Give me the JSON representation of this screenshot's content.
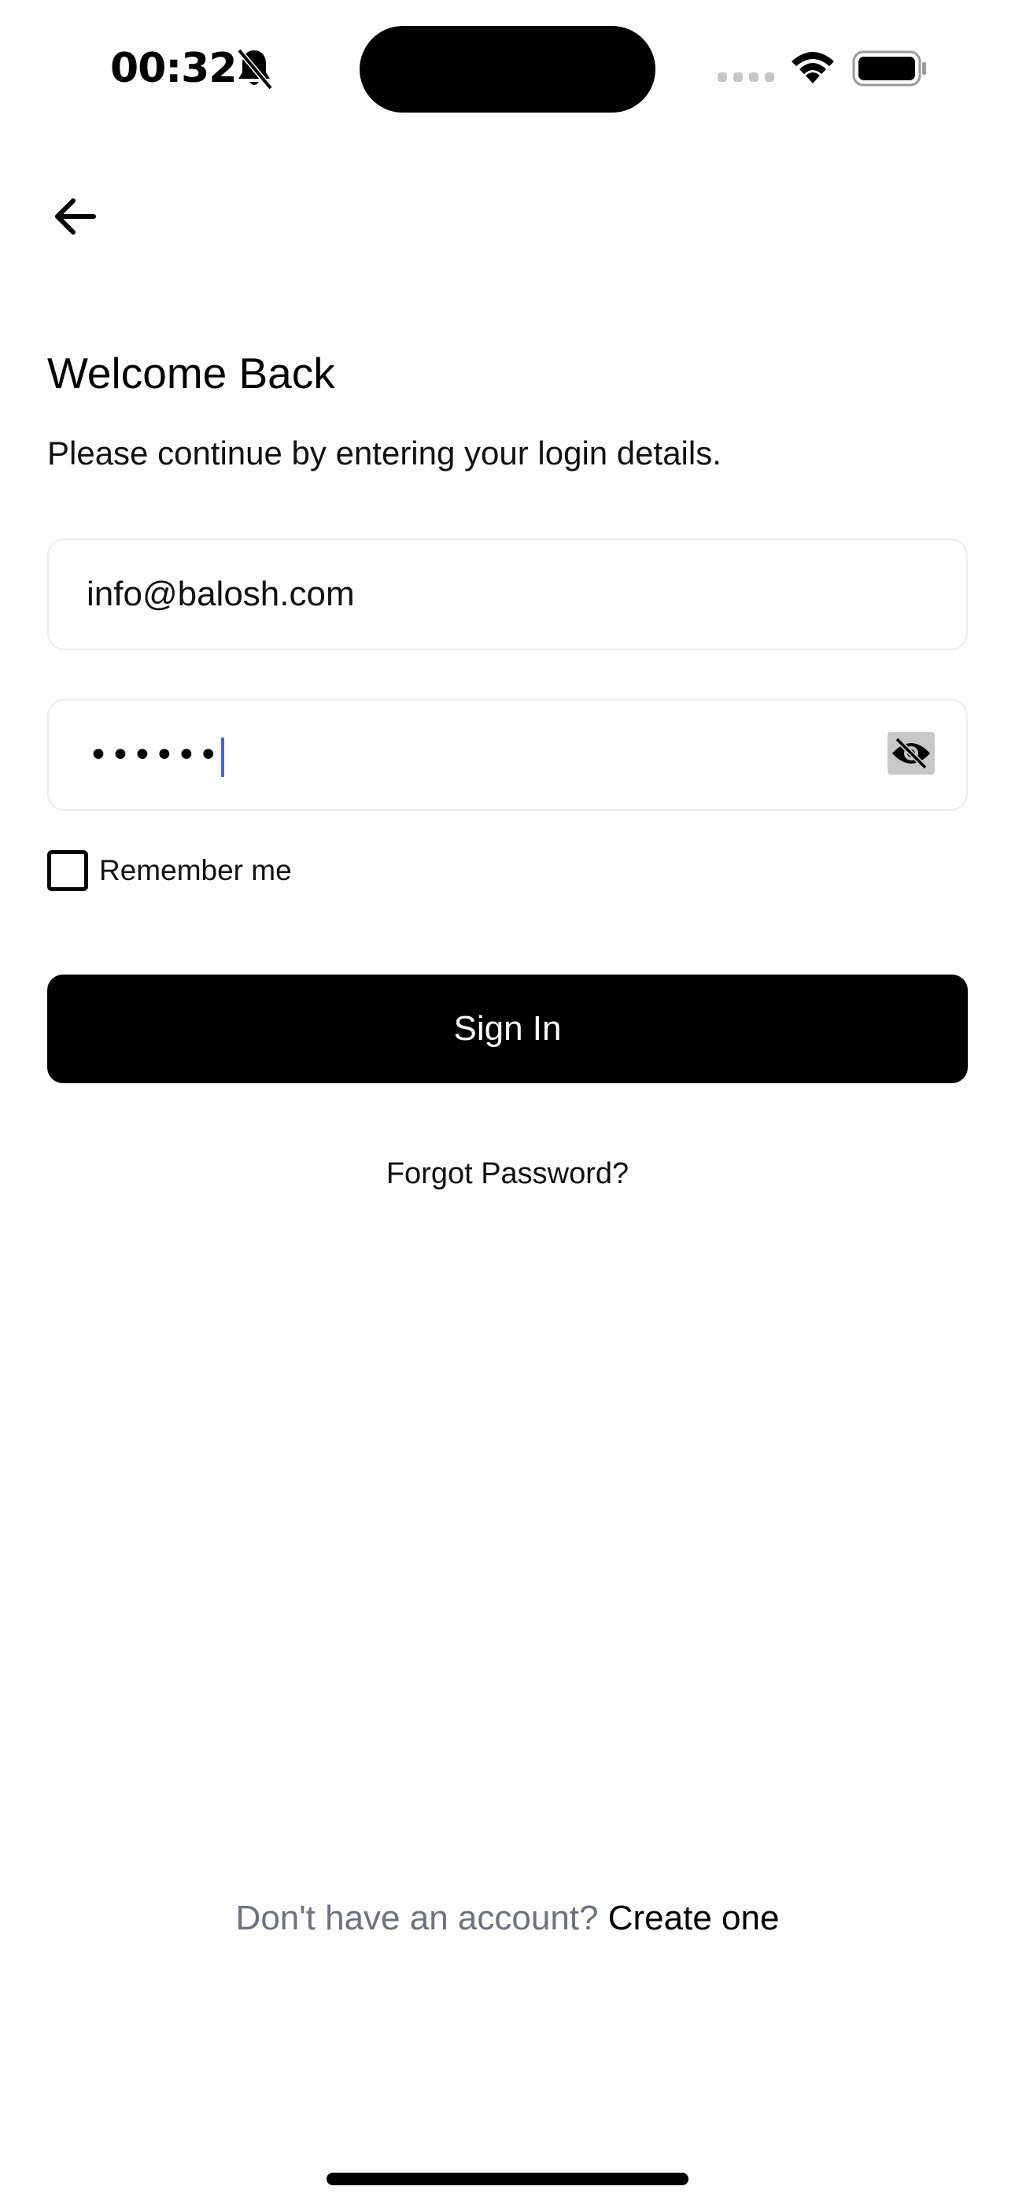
{
  "status_bar": {
    "time": "00:32",
    "icons": [
      "bell-slash-icon",
      "signal-icon",
      "wifi-icon",
      "battery-icon"
    ]
  },
  "header": {
    "back_icon": "arrow-left-icon"
  },
  "login": {
    "title": "Welcome Back",
    "subtitle": "Please continue by entering your login details.",
    "email": {
      "value": "info@balosh.com"
    },
    "password": {
      "masked_value": "••••••",
      "toggle_icon": "eye-slash-icon"
    },
    "remember_me": {
      "label": "Remember me",
      "checked": false
    },
    "sign_in_label": "Sign In",
    "forgot_password_label": "Forgot Password?"
  },
  "footer": {
    "prompt": "Don't have an account?",
    "link": "Create one"
  },
  "colors": {
    "background": "#fdfdfd",
    "primary": "#000000",
    "muted_text": "#6d7280",
    "field_border": "#ececec",
    "caret": "#4a63d8"
  }
}
